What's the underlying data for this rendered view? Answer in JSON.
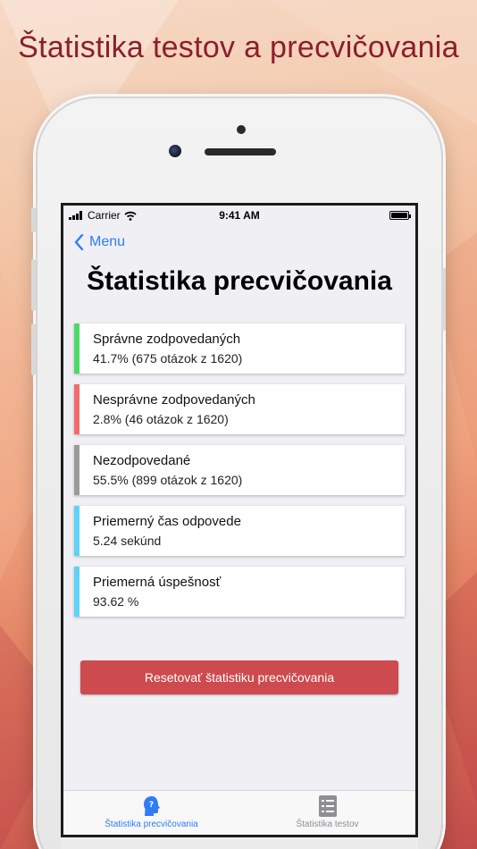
{
  "promo": {
    "title": "Štatistika testov a precvičovania"
  },
  "status_bar": {
    "carrier": "Carrier",
    "time": "9:41 AM"
  },
  "nav": {
    "back_label": "Menu"
  },
  "page": {
    "title": "Štatistika precvičovania"
  },
  "stats": [
    {
      "label": "Správne zodpovedaných",
      "value": "41.7% (675 otázok z 1620)",
      "color": "#4cd964"
    },
    {
      "label": "Nesprávne zodpovedaných",
      "value": "2.8% (46 otázok z 1620)",
      "color": "#f26b6b"
    },
    {
      "label": "Nezodpovedané",
      "value": "55.5% (899 otázok z 1620)",
      "color": "#9a9a9a"
    },
    {
      "label": "Priemerný čas odpovede",
      "value": "5.24 sekúnd",
      "color": "#5ed3f5"
    },
    {
      "label": "Priemerná úspešnosť",
      "value": "93.62 %",
      "color": "#5ed3f5"
    }
  ],
  "reset_button": {
    "label": "Resetovať štatistiku precvičovania"
  },
  "tabs": [
    {
      "label": "Štatistika precvičovania",
      "icon": "head-question-icon",
      "active": true
    },
    {
      "label": "Štatistika testov",
      "icon": "list-icon",
      "active": false
    }
  ],
  "colors": {
    "accent": "#2f7cf6",
    "danger": "#cd4a4e",
    "promo_title": "#8b1f2c"
  }
}
